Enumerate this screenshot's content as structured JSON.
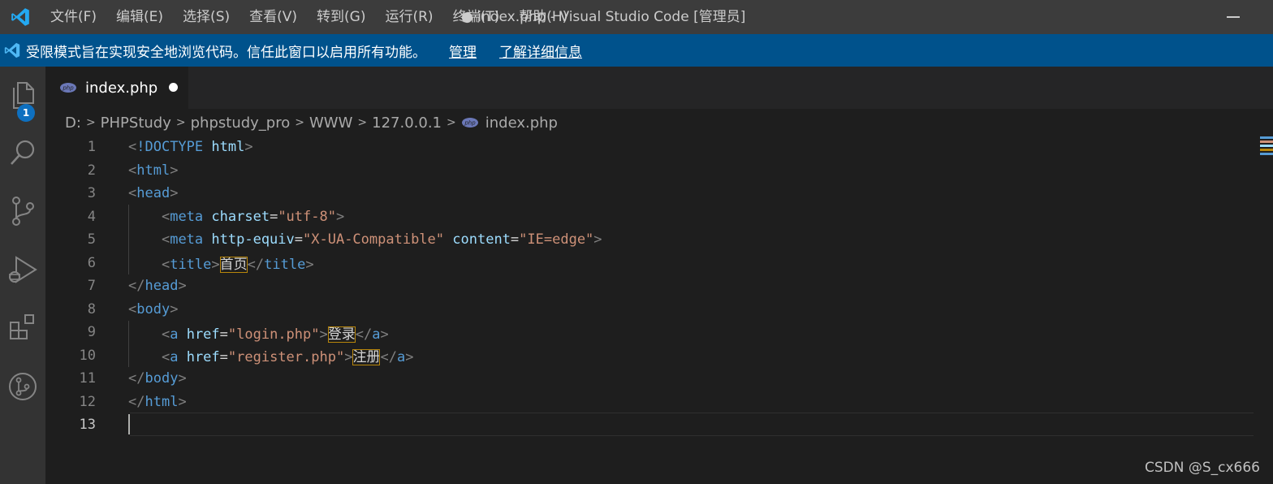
{
  "titlebar": {
    "menu": [
      "文件(F)",
      "编辑(E)",
      "选择(S)",
      "查看(V)",
      "转到(G)",
      "运行(R)",
      "终端(T)",
      "帮助(H)"
    ],
    "window_title": "● index.php - Visual Studio Code [管理员]"
  },
  "banner": {
    "text": "受限模式旨在实现安全地浏览代码。信任此窗口以启用所有功能。",
    "manage_link": "管理",
    "learn_link": "了解详细信息"
  },
  "activitybar": {
    "explorer_badge": "1",
    "icons": [
      "files-icon",
      "search-icon",
      "source-control-icon",
      "run-debug-icon",
      "extensions-icon",
      "remote-icon"
    ]
  },
  "tab": {
    "label": "index.php",
    "icon": "php-file-icon",
    "dirty": true
  },
  "breadcrumb": [
    "D:",
    "PHPStudy",
    "phpstudy_pro",
    "WWW",
    "127.0.0.1",
    "index.php"
  ],
  "editor": {
    "current_line": 13,
    "lines": [
      {
        "n": "1",
        "text": "<!DOCTYPE html>"
      },
      {
        "n": "2",
        "text": "<html>"
      },
      {
        "n": "3",
        "text": "<head>"
      },
      {
        "n": "4",
        "text": "<meta charset=\"utf-8\">"
      },
      {
        "n": "5",
        "text": "<meta http-equiv=\"X-UA-Compatible\" content=\"IE=edge\">"
      },
      {
        "n": "6",
        "text": "<title>首页</title>"
      },
      {
        "n": "7",
        "text": "</head>"
      },
      {
        "n": "8",
        "text": "<body>"
      },
      {
        "n": "9",
        "text": "<a href=\"login.php\">登录</a>"
      },
      {
        "n": "10",
        "text": "<a href=\"register.php\">注册</a>"
      },
      {
        "n": "11",
        "text": "</body>"
      },
      {
        "n": "12",
        "text": "</html>"
      },
      {
        "n": "13",
        "text": ""
      }
    ],
    "tokens": {
      "doctype_kw": "!DOCTYPE",
      "html": "html",
      "head": "head",
      "meta": "meta",
      "charset": "charset",
      "charset_val": "\"utf-8\"",
      "http_equiv": "http-equiv",
      "http_equiv_val": "\"X-UA-Compatible\"",
      "content": "content",
      "content_val": "\"IE=edge\"",
      "title": "title",
      "title_text": "首页",
      "body": "body",
      "a": "a",
      "href": "href",
      "login_val": "\"login.php\"",
      "login_text": "登录",
      "register_val": "\"register.php\"",
      "register_text": "注册"
    }
  },
  "watermark": "CSDN @S_cx666",
  "colors": {
    "titlebar": "#3c3c3c",
    "banner": "#00528c",
    "activitybar": "#333333",
    "editor_bg": "#1e1e1e",
    "tag": "#569cd6",
    "attr": "#9cdcfe",
    "string": "#ce9178",
    "bracket": "#808080",
    "vscode_blue": "#0e70c0"
  }
}
